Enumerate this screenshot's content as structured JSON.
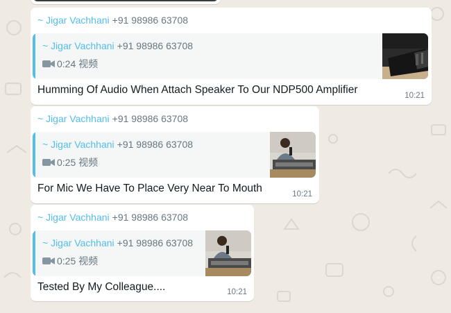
{
  "messages": [
    {
      "sender_name": "~ Jigar Vachhani",
      "sender_phone": "+91 98986 63708",
      "quote": {
        "sender_name": "~ Jigar Vachhani",
        "sender_phone": "+91 98986 63708",
        "duration": "0:24",
        "media_label": "视频"
      },
      "text": "Humming Of Audio When Attach Speaker To Our NDP500 Amplifier",
      "time": "10:21"
    },
    {
      "sender_name": "~ Jigar Vachhani",
      "sender_phone": "+91 98986 63708",
      "quote": {
        "sender_name": "~ Jigar Vachhani",
        "sender_phone": "+91 98986 63708",
        "duration": "0:25",
        "media_label": "视频"
      },
      "text": "For Mic We Have To Place Very Near To Mouth",
      "time": "10:21"
    },
    {
      "sender_name": "~ Jigar Vachhani",
      "sender_phone": "+91 98986 63708",
      "quote": {
        "sender_name": "~ Jigar Vachhani",
        "sender_phone": "+91 98986 63708",
        "duration": "0:25",
        "media_label": "视频"
      },
      "text": "Tested By My Colleague....",
      "time": "10:21"
    }
  ],
  "icons": {
    "quote_media_icon": "video-camera-icon"
  },
  "colors": {
    "background": "#efeae2",
    "bubble": "#ffffff",
    "quote_bg": "#f5f6f6",
    "accent": "#53bdeb",
    "secondary_text": "#667781",
    "primary_text": "#111b21"
  }
}
